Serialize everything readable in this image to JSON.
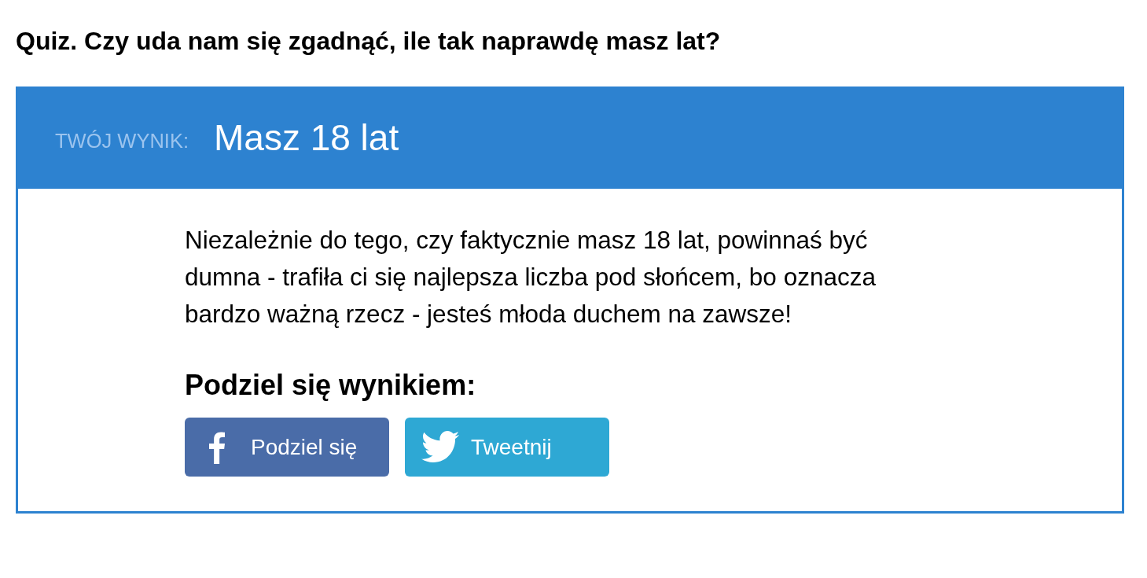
{
  "title": "Quiz. Czy uda nam się zgadnąć, ile tak naprawdę masz lat?",
  "result": {
    "label": "TWÓJ WYNIK:",
    "value": "Masz 18 lat",
    "description": "Niezależnie do tego, czy faktycznie masz 18 lat, powinnaś być dumna - trafiła ci się najlepsza liczba pod słońcem, bo oznacza bardzo ważną rzecz - jesteś młoda duchem na zawsze!",
    "share_heading": "Podziel się wynikiem:",
    "share_buttons": [
      {
        "kind": "facebook",
        "label": "Podziel się"
      },
      {
        "kind": "twitter",
        "label": "Tweetnij"
      }
    ]
  }
}
